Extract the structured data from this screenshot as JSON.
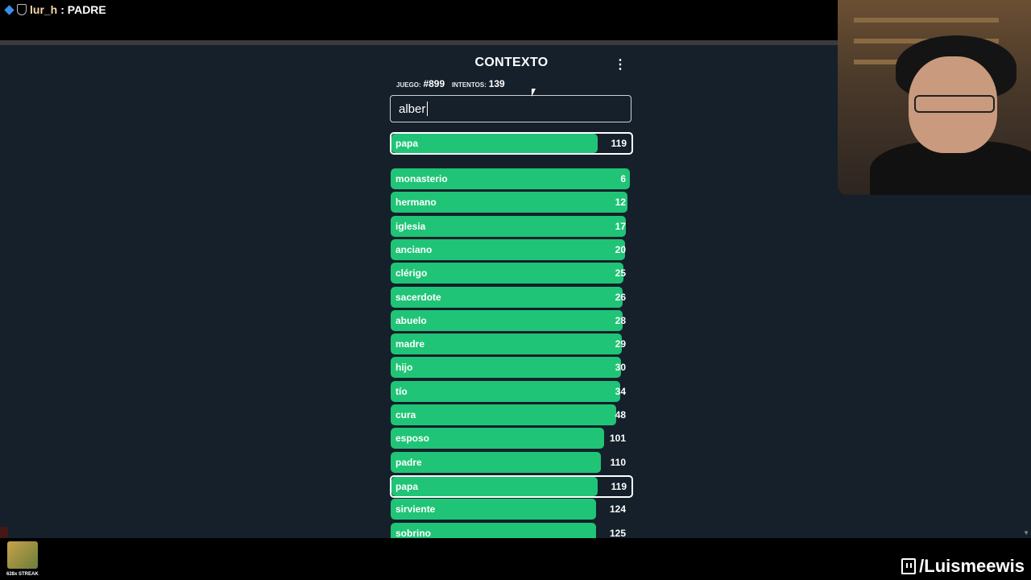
{
  "overlay": {
    "chat_user": "lur_h",
    "chat_message": ": PADRE",
    "streak_label": "628x STREAK",
    "channel": "/Luismeewis"
  },
  "game": {
    "title": "CONTEXTO",
    "menu_icon": "⋮",
    "game_label": "JUEGO:",
    "game_number": "#899",
    "attempts_label": "INTENTOS:",
    "attempts_value": "139",
    "input_value": "alber",
    "last_guess": {
      "word": "papa",
      "rank": "119",
      "fill_fraction": 0.86
    },
    "guesses": [
      {
        "word": "monasterio",
        "rank": "6",
        "fill_fraction": 0.997
      },
      {
        "word": "hermano",
        "rank": "12",
        "fill_fraction": 0.985
      },
      {
        "word": "iglesia",
        "rank": "17",
        "fill_fraction": 0.98
      },
      {
        "word": "anciano",
        "rank": "20",
        "fill_fraction": 0.975
      },
      {
        "word": "clérigo",
        "rank": "25",
        "fill_fraction": 0.97
      },
      {
        "word": "sacerdote",
        "rank": "26",
        "fill_fraction": 0.968
      },
      {
        "word": "abuelo",
        "rank": "28",
        "fill_fraction": 0.965
      },
      {
        "word": "madre",
        "rank": "29",
        "fill_fraction": 0.963
      },
      {
        "word": "hijo",
        "rank": "30",
        "fill_fraction": 0.96
      },
      {
        "word": "tío",
        "rank": "34",
        "fill_fraction": 0.955
      },
      {
        "word": "cura",
        "rank": "48",
        "fill_fraction": 0.94
      },
      {
        "word": "esposo",
        "rank": "101",
        "fill_fraction": 0.89
      },
      {
        "word": "padre",
        "rank": "110",
        "fill_fraction": 0.875
      },
      {
        "word": "papa",
        "rank": "119",
        "fill_fraction": 0.86,
        "current": true
      },
      {
        "word": "sirviente",
        "rank": "124",
        "fill_fraction": 0.855
      },
      {
        "word": "sobrino",
        "rank": "125",
        "fill_fraction": 0.855
      }
    ]
  }
}
